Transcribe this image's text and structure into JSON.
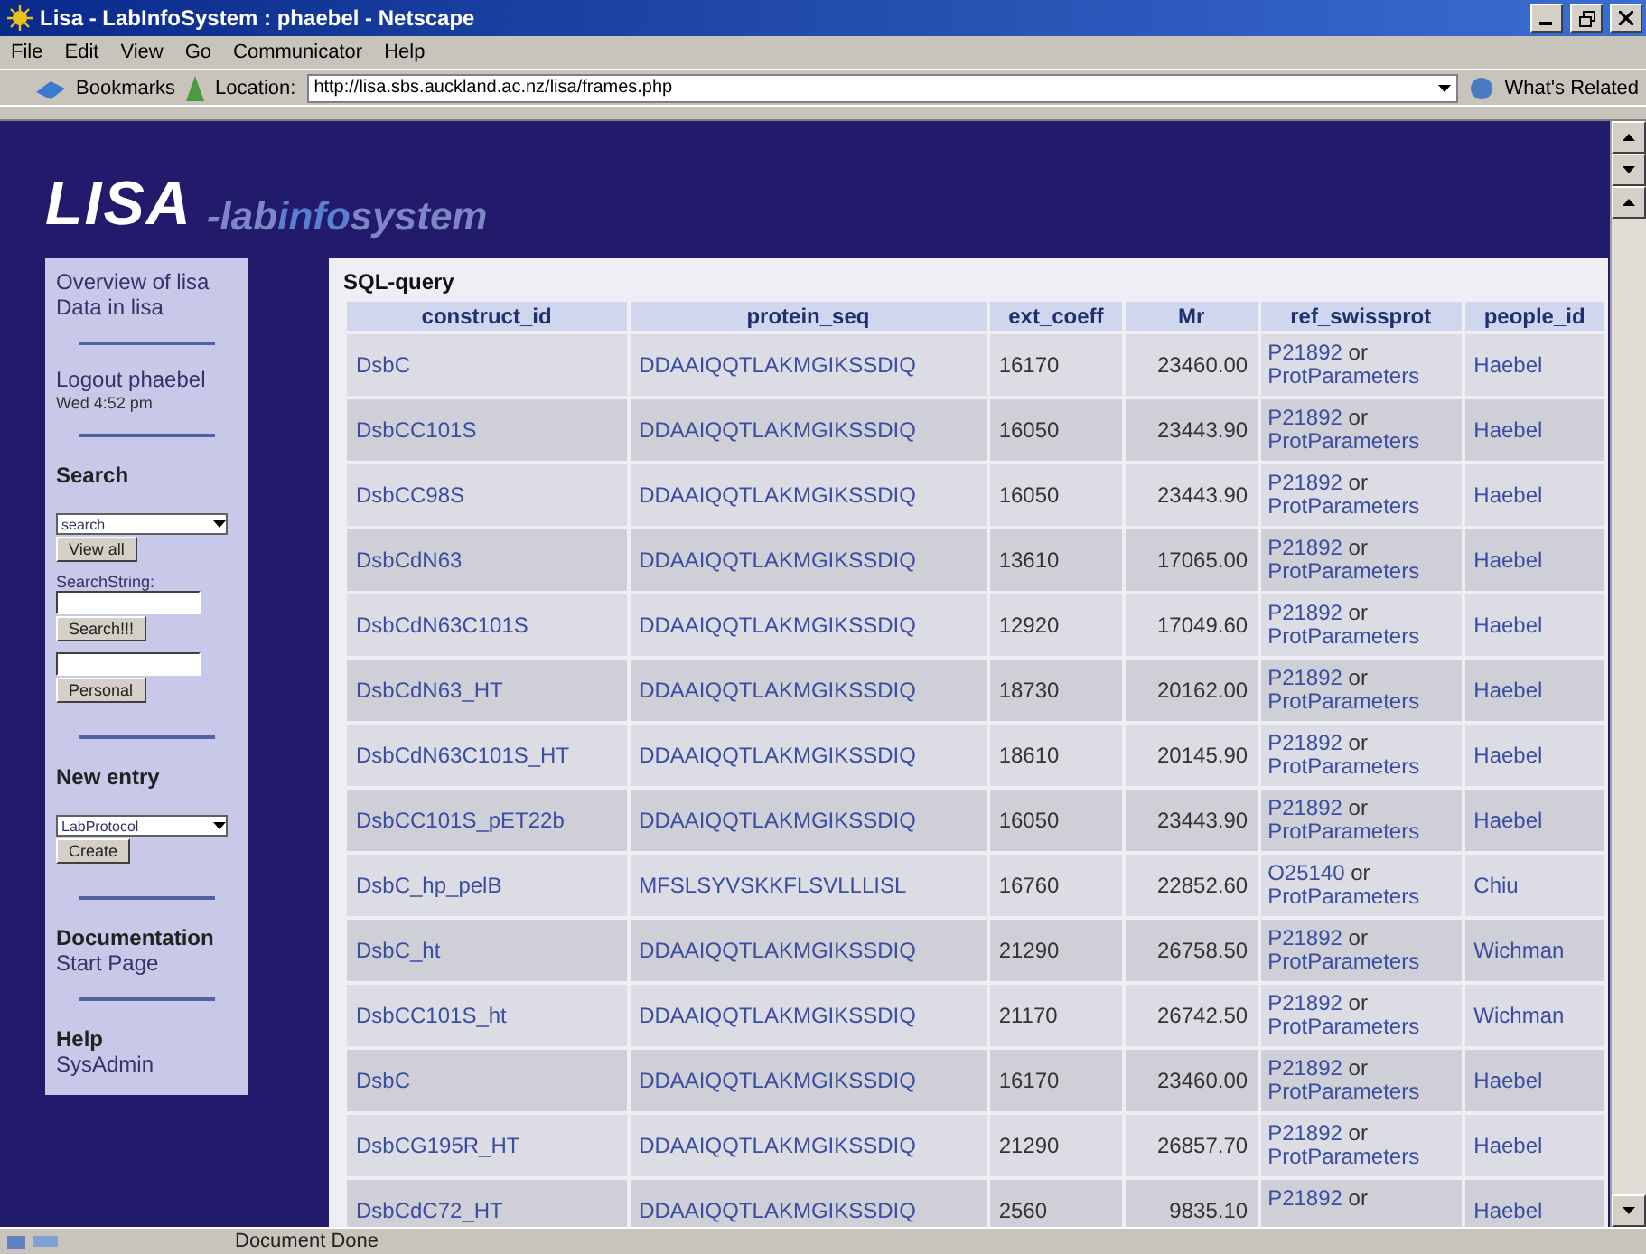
{
  "window": {
    "title": "Lisa - LabInfoSystem : phaebel - Netscape"
  },
  "menu": [
    "File",
    "Edit",
    "View",
    "Go",
    "Communicator",
    "Help"
  ],
  "toolbar": {
    "bookmarks": "Bookmarks",
    "location_label": "Location:",
    "url": "http://lisa.sbs.auckland.ac.nz/lisa/frames.php",
    "related": "What's Related"
  },
  "logo": {
    "main": "LISA",
    "parts": [
      {
        "text": "-lab",
        "color": "#7f86c8"
      },
      {
        "text": "info",
        "color": "#5a7fd0"
      },
      {
        "text": "system",
        "color": "#7f86c8"
      }
    ]
  },
  "sidebar": {
    "items": [
      {
        "kind": "link",
        "text": "Overview of lisa"
      },
      {
        "kind": "link",
        "text": "Data in lisa"
      },
      {
        "kind": "divider"
      },
      {
        "kind": "link",
        "text": "Logout phaebel"
      },
      {
        "kind": "small",
        "text": "Wed 4:52 pm"
      },
      {
        "kind": "divider"
      },
      {
        "kind": "heading",
        "text": "Search"
      },
      {
        "kind": "select",
        "text": "search"
      },
      {
        "kind": "button",
        "text": "View all"
      },
      {
        "kind": "label",
        "text": "SearchString:"
      },
      {
        "kind": "input"
      },
      {
        "kind": "button",
        "text": "Search!!!"
      },
      {
        "kind": "input"
      },
      {
        "kind": "button",
        "text": "Personal"
      },
      {
        "kind": "divider"
      },
      {
        "kind": "heading",
        "text": "New entry"
      },
      {
        "kind": "select",
        "text": "LabProtocol"
      },
      {
        "kind": "button",
        "text": "Create"
      },
      {
        "kind": "divider"
      },
      {
        "kind": "heading",
        "text": "Documentation"
      },
      {
        "kind": "link",
        "text": "Start Page"
      },
      {
        "kind": "divider"
      },
      {
        "kind": "heading",
        "text": "Help"
      },
      {
        "kind": "link",
        "text": "SysAdmin"
      }
    ]
  },
  "table": {
    "title": "SQL-query",
    "columns": [
      "construct_id",
      "protein_seq",
      "ext_coeff",
      "Mr",
      "ref_swissprot",
      "people_id"
    ],
    "rows": [
      {
        "construct_id": "DsbC",
        "protein_seq": "DDAAIQQTLAKMGIKSSDIQ",
        "ext_coeff": "16170",
        "mr": "23460.00",
        "ref": "P21892",
        "connector": "or",
        "ref_link": "ProtParameters",
        "people_id": "Haebel"
      },
      {
        "construct_id": "DsbCC101S",
        "protein_seq": "DDAAIQQTLAKMGIKSSDIQ",
        "ext_coeff": "16050",
        "mr": "23443.90",
        "ref": "P21892",
        "connector": "or",
        "ref_link": "ProtParameters",
        "people_id": "Haebel"
      },
      {
        "construct_id": "DsbCC98S",
        "protein_seq": "DDAAIQQTLAKMGIKSSDIQ",
        "ext_coeff": "16050",
        "mr": "23443.90",
        "ref": "P21892",
        "connector": "or",
        "ref_link": "ProtParameters",
        "people_id": "Haebel"
      },
      {
        "construct_id": "DsbCdN63",
        "protein_seq": "DDAAIQQTLAKMGIKSSDIQ",
        "ext_coeff": "13610",
        "mr": "17065.00",
        "ref": "P21892",
        "connector": "or",
        "ref_link": "ProtParameters",
        "people_id": "Haebel"
      },
      {
        "construct_id": "DsbCdN63C101S",
        "protein_seq": "DDAAIQQTLAKMGIKSSDIQ",
        "ext_coeff": "12920",
        "mr": "17049.60",
        "ref": "P21892",
        "connector": "or",
        "ref_link": "ProtParameters",
        "people_id": "Haebel"
      },
      {
        "construct_id": "DsbCdN63_HT",
        "protein_seq": "DDAAIQQTLAKMGIKSSDIQ",
        "ext_coeff": "18730",
        "mr": "20162.00",
        "ref": "P21892",
        "connector": "or",
        "ref_link": "ProtParameters",
        "people_id": "Haebel"
      },
      {
        "construct_id": "DsbCdN63C101S_HT",
        "protein_seq": "DDAAIQQTLAKMGIKSSDIQ",
        "ext_coeff": "18610",
        "mr": "20145.90",
        "ref": "P21892",
        "connector": "or",
        "ref_link": "ProtParameters",
        "people_id": "Haebel"
      },
      {
        "construct_id": "DsbCC101S_pET22b",
        "protein_seq": "DDAAIQQTLAKMGIKSSDIQ",
        "ext_coeff": "16050",
        "mr": "23443.90",
        "ref": "P21892",
        "connector": "or",
        "ref_link": "ProtParameters",
        "people_id": "Haebel"
      },
      {
        "construct_id": "DsbC_hp_pelB",
        "protein_seq": "MFSLSYVSKKFLSVLLLISL",
        "ext_coeff": "16760",
        "mr": "22852.60",
        "ref": "O25140",
        "connector": "or",
        "ref_link": "ProtParameters",
        "people_id": "Chiu"
      },
      {
        "construct_id": "DsbC_ht",
        "protein_seq": "DDAAIQQTLAKMGIKSSDIQ",
        "ext_coeff": "21290",
        "mr": "26758.50",
        "ref": "P21892",
        "connector": "or",
        "ref_link": "ProtParameters",
        "people_id": "Wichman"
      },
      {
        "construct_id": "DsbCC101S_ht",
        "protein_seq": "DDAAIQQTLAKMGIKSSDIQ",
        "ext_coeff": "21170",
        "mr": "26742.50",
        "ref": "P21892",
        "connector": "or",
        "ref_link": "ProtParameters",
        "people_id": "Wichman"
      },
      {
        "construct_id": "DsbC",
        "protein_seq": "DDAAIQQTLAKMGIKSSDIQ",
        "ext_coeff": "16170",
        "mr": "23460.00",
        "ref": "P21892",
        "connector": "or",
        "ref_link": "ProtParameters",
        "people_id": "Haebel"
      },
      {
        "construct_id": "DsbCG195R_HT",
        "protein_seq": "DDAAIQQTLAKMGIKSSDIQ",
        "ext_coeff": "21290",
        "mr": "26857.70",
        "ref": "P21892",
        "connector": "or",
        "ref_link": "ProtParameters",
        "people_id": "Haebel"
      },
      {
        "construct_id": "DsbCdC72_HT",
        "protein_seq": "DDAAIQQTLAKMGIKSSDIQ",
        "ext_coeff": "2560",
        "mr": "9835.10",
        "ref": "P21892",
        "connector": "or",
        "people_id": "Haebel"
      }
    ]
  },
  "status_bar": {
    "text": "Document Done"
  }
}
